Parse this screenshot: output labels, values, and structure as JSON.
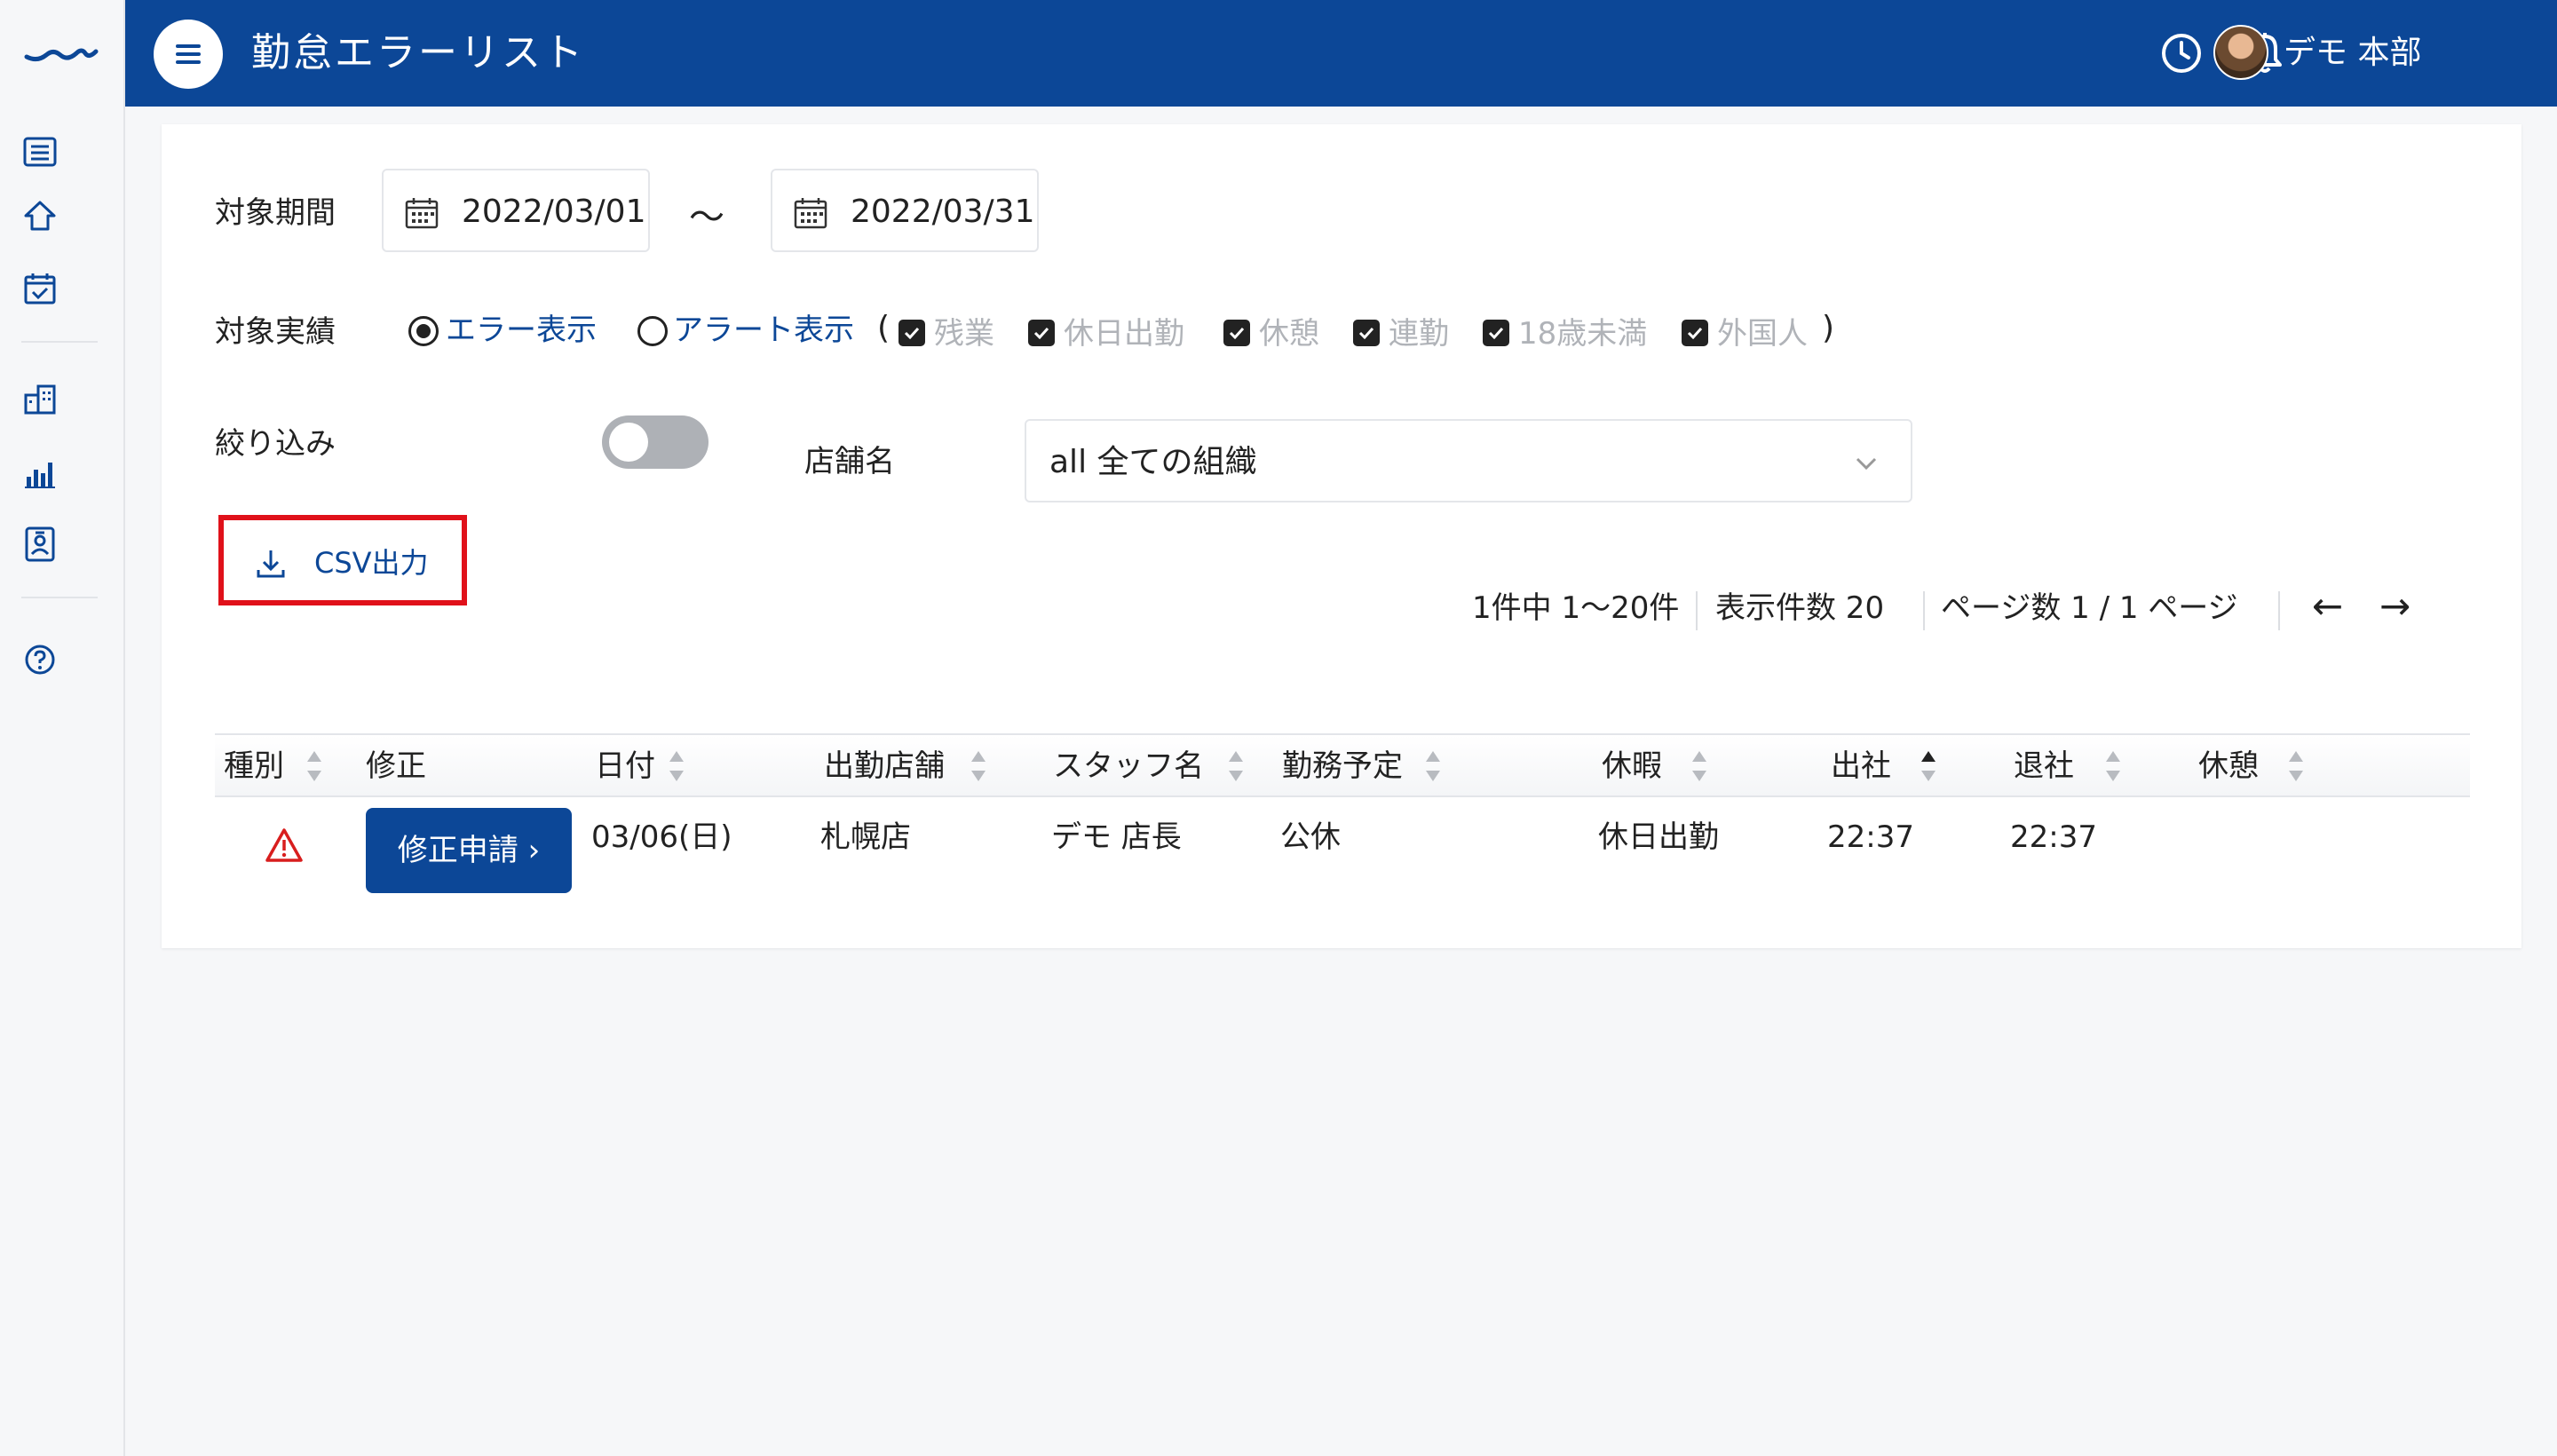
{
  "header": {
    "title": "勤怠エラーリスト",
    "user_name": "デモ 本部"
  },
  "sidebar": {
    "icons": [
      "logo-icon",
      "list-icon",
      "home-icon",
      "calendar-check-icon",
      "building-icon",
      "bar-chart-icon",
      "id-badge-icon",
      "help-icon"
    ]
  },
  "filters": {
    "period_label": "対象期間",
    "date_from": "2022/03/01",
    "tilde": "〜",
    "date_to": "2022/03/31",
    "target_label": "対象実績",
    "radio_error": "エラー表示",
    "radio_alert": "アラート表示",
    "paren_open": "(",
    "paren_close": ")",
    "checkboxes": [
      "残業",
      "休日出勤",
      "休憩",
      "連勤",
      "18歳未満",
      "外国人"
    ],
    "narrow_label": "絞り込み",
    "store_label": "店舗名",
    "store_value": "all 全ての組織",
    "csv_label": "CSV出力"
  },
  "pager": {
    "range": "1件中 1〜20件",
    "per_page": "表示件数  20",
    "pages": "ページ数  1 / 1 ページ",
    "prev": "←",
    "next": "→"
  },
  "table": {
    "headers": [
      "種別",
      "修正",
      "日付",
      "出勤店舗",
      "スタッフ名",
      "勤務予定",
      "休暇",
      "出社",
      "退社",
      "休憩"
    ],
    "rows": [
      {
        "fix_button": "修正申請 ›",
        "date": "03/06(日)",
        "store": "札幌店",
        "staff": "デモ 店長",
        "schedule": "公休",
        "leave": "休日出勤",
        "clock_in": "22:37",
        "clock_out": "22:37",
        "break": ""
      }
    ]
  },
  "colors": {
    "brand": "#0c4797",
    "highlight": "#e0111a",
    "warning": "#d81e1e"
  }
}
